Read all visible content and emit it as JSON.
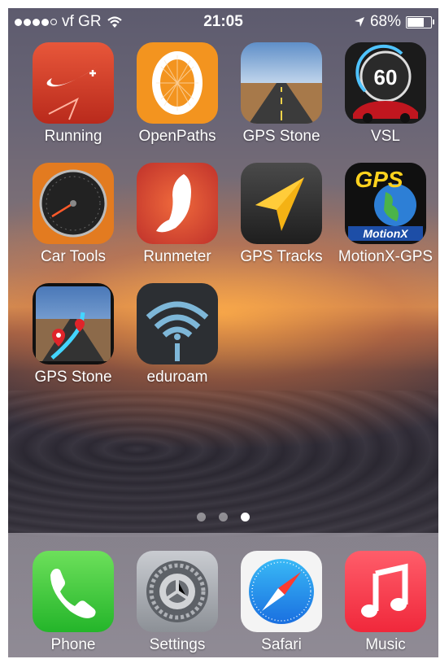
{
  "status_bar": {
    "carrier": "vf GR",
    "time": "21:05",
    "battery": "68%",
    "battery_level": 0.68,
    "signal_bars_filled": 4,
    "signal_bars_total": 5
  },
  "apps": [
    {
      "label": "Running",
      "icon": "nike-running-icon"
    },
    {
      "label": "OpenPaths",
      "icon": "openpaths-icon"
    },
    {
      "label": "GPS Stone",
      "icon": "gps-stone-road-icon"
    },
    {
      "label": "VSL",
      "icon": "vsl-speedometer-icon"
    },
    {
      "label": "Car Tools",
      "icon": "car-tools-gauge-icon"
    },
    {
      "label": "Runmeter",
      "icon": "runmeter-shoe-icon"
    },
    {
      "label": "GPS Tracks",
      "icon": "gps-tracks-arrow-icon"
    },
    {
      "label": "MotionX-GPS",
      "icon": "motionx-globe-icon"
    },
    {
      "label": "GPS Stone",
      "icon": "gps-stone-map-icon"
    },
    {
      "label": "eduroam",
      "icon": "eduroam-wifi-icon"
    }
  ],
  "vsl_speed": "60",
  "motionx_text": {
    "top": "GPS",
    "bottom": "MotionX"
  },
  "page_indicator": {
    "pages": 3,
    "active": 3
  },
  "dock": [
    {
      "label": "Phone",
      "icon": "phone-icon"
    },
    {
      "label": "Settings",
      "icon": "settings-gear-icon"
    },
    {
      "label": "Safari",
      "icon": "safari-compass-icon"
    },
    {
      "label": "Music",
      "icon": "music-note-icon"
    }
  ]
}
